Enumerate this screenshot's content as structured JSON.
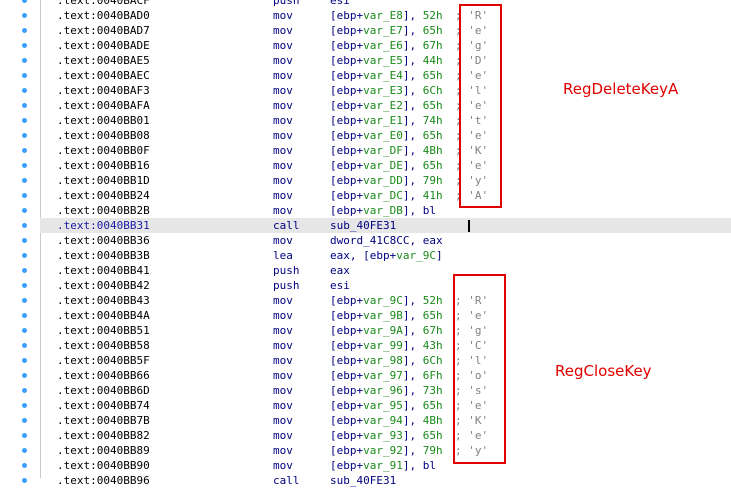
{
  "annotations": {
    "box1_label": "RegDeleteKeyA",
    "box2_label": "RegCloseKey",
    "color": "#e00000"
  },
  "rows": [
    {
      "addr": ".text:0040BACF",
      "mn": "push",
      "ops": [
        [
          "esi",
          "r"
        ]
      ],
      "cmt": ""
    },
    {
      "addr": ".text:0040BAD0",
      "mn": "mov",
      "ops": [
        [
          "[ebp+",
          "r"
        ],
        [
          "var_E8",
          "v"
        ],
        [
          "], ",
          "r"
        ],
        [
          "52h",
          "i"
        ]
      ],
      "cmt": "'R'"
    },
    {
      "addr": ".text:0040BAD7",
      "mn": "mov",
      "ops": [
        [
          "[ebp+",
          "r"
        ],
        [
          "var_E7",
          "v"
        ],
        [
          "], ",
          "r"
        ],
        [
          "65h",
          "i"
        ]
      ],
      "cmt": "'e'"
    },
    {
      "addr": ".text:0040BADE",
      "mn": "mov",
      "ops": [
        [
          "[ebp+",
          "r"
        ],
        [
          "var_E6",
          "v"
        ],
        [
          "], ",
          "r"
        ],
        [
          "67h",
          "i"
        ]
      ],
      "cmt": "'g'"
    },
    {
      "addr": ".text:0040BAE5",
      "mn": "mov",
      "ops": [
        [
          "[ebp+",
          "r"
        ],
        [
          "var_E5",
          "v"
        ],
        [
          "], ",
          "r"
        ],
        [
          "44h",
          "i"
        ]
      ],
      "cmt": "'D'"
    },
    {
      "addr": ".text:0040BAEC",
      "mn": "mov",
      "ops": [
        [
          "[ebp+",
          "r"
        ],
        [
          "var_E4",
          "v"
        ],
        [
          "], ",
          "r"
        ],
        [
          "65h",
          "i"
        ]
      ],
      "cmt": "'e'"
    },
    {
      "addr": ".text:0040BAF3",
      "mn": "mov",
      "ops": [
        [
          "[ebp+",
          "r"
        ],
        [
          "var_E3",
          "v"
        ],
        [
          "], ",
          "r"
        ],
        [
          "6Ch",
          "i"
        ]
      ],
      "cmt": "'l'"
    },
    {
      "addr": ".text:0040BAFA",
      "mn": "mov",
      "ops": [
        [
          "[ebp+",
          "r"
        ],
        [
          "var_E2",
          "v"
        ],
        [
          "], ",
          "r"
        ],
        [
          "65h",
          "i"
        ]
      ],
      "cmt": "'e'"
    },
    {
      "addr": ".text:0040BB01",
      "mn": "mov",
      "ops": [
        [
          "[ebp+",
          "r"
        ],
        [
          "var_E1",
          "v"
        ],
        [
          "], ",
          "r"
        ],
        [
          "74h",
          "i"
        ]
      ],
      "cmt": "'t'"
    },
    {
      "addr": ".text:0040BB08",
      "mn": "mov",
      "ops": [
        [
          "[ebp+",
          "r"
        ],
        [
          "var_E0",
          "v"
        ],
        [
          "], ",
          "r"
        ],
        [
          "65h",
          "i"
        ]
      ],
      "cmt": "'e'"
    },
    {
      "addr": ".text:0040BB0F",
      "mn": "mov",
      "ops": [
        [
          "[ebp+",
          "r"
        ],
        [
          "var_DF",
          "v"
        ],
        [
          "], ",
          "r"
        ],
        [
          "4Bh",
          "i"
        ]
      ],
      "cmt": "'K'"
    },
    {
      "addr": ".text:0040BB16",
      "mn": "mov",
      "ops": [
        [
          "[ebp+",
          "r"
        ],
        [
          "var_DE",
          "v"
        ],
        [
          "], ",
          "r"
        ],
        [
          "65h",
          "i"
        ]
      ],
      "cmt": "'e'"
    },
    {
      "addr": ".text:0040BB1D",
      "mn": "mov",
      "ops": [
        [
          "[ebp+",
          "r"
        ],
        [
          "var_DD",
          "v"
        ],
        [
          "], ",
          "r"
        ],
        [
          "79h",
          "i"
        ]
      ],
      "cmt": "'y'"
    },
    {
      "addr": ".text:0040BB24",
      "mn": "mov",
      "ops": [
        [
          "[ebp+",
          "r"
        ],
        [
          "var_DC",
          "v"
        ],
        [
          "], ",
          "r"
        ],
        [
          "41h",
          "i"
        ]
      ],
      "cmt": "'A'"
    },
    {
      "addr": ".text:0040BB2B",
      "mn": "mov",
      "ops": [
        [
          "[ebp+",
          "r"
        ],
        [
          "var_DB",
          "v"
        ],
        [
          "], bl",
          "r"
        ]
      ],
      "cmt": ""
    },
    {
      "addr": ".text:0040BB31",
      "mn": "call",
      "ops": [
        [
          "sub_40FE31",
          "r"
        ]
      ],
      "cmt": "",
      "hl": true
    },
    {
      "addr": ".text:0040BB36",
      "mn": "mov",
      "ops": [
        [
          "dword_41C8CC, eax",
          "r"
        ]
      ],
      "cmt": ""
    },
    {
      "addr": ".text:0040BB3B",
      "mn": "lea",
      "ops": [
        [
          "eax, [ebp+",
          "r"
        ],
        [
          "var_9C",
          "v"
        ],
        [
          "]",
          "r"
        ]
      ],
      "cmt": ""
    },
    {
      "addr": ".text:0040BB41",
      "mn": "push",
      "ops": [
        [
          "eax",
          "r"
        ]
      ],
      "cmt": ""
    },
    {
      "addr": ".text:0040BB42",
      "mn": "push",
      "ops": [
        [
          "esi",
          "r"
        ]
      ],
      "cmt": ""
    },
    {
      "addr": ".text:0040BB43",
      "mn": "mov",
      "ops": [
        [
          "[ebp+",
          "r"
        ],
        [
          "var_9C",
          "v"
        ],
        [
          "], ",
          "r"
        ],
        [
          "52h",
          "i"
        ]
      ],
      "cmt": "'R'"
    },
    {
      "addr": ".text:0040BB4A",
      "mn": "mov",
      "ops": [
        [
          "[ebp+",
          "r"
        ],
        [
          "var_9B",
          "v"
        ],
        [
          "], ",
          "r"
        ],
        [
          "65h",
          "i"
        ]
      ],
      "cmt": "'e'"
    },
    {
      "addr": ".text:0040BB51",
      "mn": "mov",
      "ops": [
        [
          "[ebp+",
          "r"
        ],
        [
          "var_9A",
          "v"
        ],
        [
          "], ",
          "r"
        ],
        [
          "67h",
          "i"
        ]
      ],
      "cmt": "'g'"
    },
    {
      "addr": ".text:0040BB58",
      "mn": "mov",
      "ops": [
        [
          "[ebp+",
          "r"
        ],
        [
          "var_99",
          "v"
        ],
        [
          "], ",
          "r"
        ],
        [
          "43h",
          "i"
        ]
      ],
      "cmt": "'C'"
    },
    {
      "addr": ".text:0040BB5F",
      "mn": "mov",
      "ops": [
        [
          "[ebp+",
          "r"
        ],
        [
          "var_98",
          "v"
        ],
        [
          "], ",
          "r"
        ],
        [
          "6Ch",
          "i"
        ]
      ],
      "cmt": "'l'"
    },
    {
      "addr": ".text:0040BB66",
      "mn": "mov",
      "ops": [
        [
          "[ebp+",
          "r"
        ],
        [
          "var_97",
          "v"
        ],
        [
          "], ",
          "r"
        ],
        [
          "6Fh",
          "i"
        ]
      ],
      "cmt": "'o'"
    },
    {
      "addr": ".text:0040BB6D",
      "mn": "mov",
      "ops": [
        [
          "[ebp+",
          "r"
        ],
        [
          "var_96",
          "v"
        ],
        [
          "], ",
          "r"
        ],
        [
          "73h",
          "i"
        ]
      ],
      "cmt": "'s'"
    },
    {
      "addr": ".text:0040BB74",
      "mn": "mov",
      "ops": [
        [
          "[ebp+",
          "r"
        ],
        [
          "var_95",
          "v"
        ],
        [
          "], ",
          "r"
        ],
        [
          "65h",
          "i"
        ]
      ],
      "cmt": "'e'"
    },
    {
      "addr": ".text:0040BB7B",
      "mn": "mov",
      "ops": [
        [
          "[ebp+",
          "r"
        ],
        [
          "var_94",
          "v"
        ],
        [
          "], ",
          "r"
        ],
        [
          "4Bh",
          "i"
        ]
      ],
      "cmt": "'K'"
    },
    {
      "addr": ".text:0040BB82",
      "mn": "mov",
      "ops": [
        [
          "[ebp+",
          "r"
        ],
        [
          "var_93",
          "v"
        ],
        [
          "], ",
          "r"
        ],
        [
          "65h",
          "i"
        ]
      ],
      "cmt": "'e'"
    },
    {
      "addr": ".text:0040BB89",
      "mn": "mov",
      "ops": [
        [
          "[ebp+",
          "r"
        ],
        [
          "var_92",
          "v"
        ],
        [
          "], ",
          "r"
        ],
        [
          "79h",
          "i"
        ]
      ],
      "cmt": "'y'"
    },
    {
      "addr": ".text:0040BB90",
      "mn": "mov",
      "ops": [
        [
          "[ebp+",
          "r"
        ],
        [
          "var_91",
          "v"
        ],
        [
          "], bl",
          "r"
        ]
      ],
      "cmt": ""
    },
    {
      "addr": ".text:0040BB96",
      "mn": "call",
      "ops": [
        [
          "sub_40FE31",
          "r"
        ]
      ],
      "cmt": ""
    }
  ]
}
